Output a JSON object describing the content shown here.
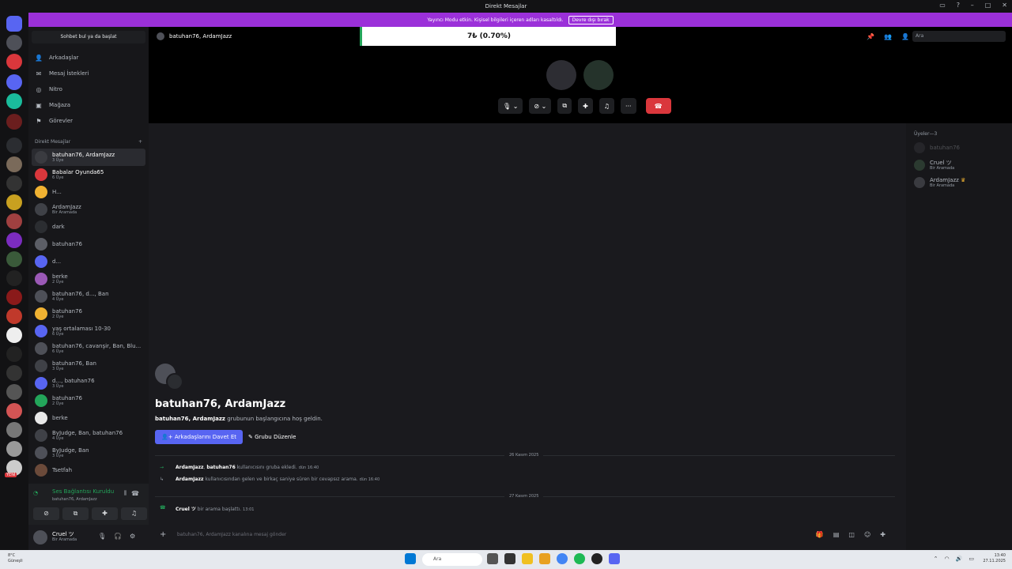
{
  "window": {
    "title": "Direkt Mesajlar"
  },
  "banner": {
    "text": "Yayıncı Modu etkin. Kişisel bilgileri içeren adları kasaltıldı.",
    "button": "Devre dışı bırak"
  },
  "sidebar": {
    "search_placeholder": "Sohbet bul ya da başlat",
    "nav": [
      "Arkadaşlar",
      "Mesaj İstekleri",
      "Nitro",
      "Mağaza",
      "Görevler"
    ],
    "dm_header": "Direkt Mesajlar",
    "dm_add": "+",
    "dms": [
      {
        "name": "batuhan76, ArdamJazz",
        "sub": "3 Üye",
        "color": "#3a3b40"
      },
      {
        "name": "Babalar Oyunda65",
        "sub": "6 Üye",
        "color": "#da373c"
      },
      {
        "name": "H...",
        "sub": "",
        "color": "#f0b232"
      },
      {
        "name": "ArdamJazz",
        "sub": "Bir Aramada",
        "color": "#3f4147"
      },
      {
        "name": "dark",
        "sub": "",
        "color": "#2b2d31"
      },
      {
        "name": "batuhan76",
        "sub": "",
        "color": "#5c5e66"
      },
      {
        "name": "d...",
        "sub": "",
        "color": "#5865f2"
      },
      {
        "name": "berke",
        "sub": "2 Üye",
        "color": "#9b59b6"
      },
      {
        "name": "batuhan76, d..., Ban",
        "sub": "4 Üye",
        "color": "#4e5058"
      },
      {
        "name": "batuhan76",
        "sub": "2 Üye",
        "color": "#f0b232"
      },
      {
        "name": "yaş ortalaması 10-30",
        "sub": "6 Üye",
        "color": "#5865f2"
      },
      {
        "name": "batuhan76, cavanşir, Ban, Blu...",
        "sub": "6 Üye",
        "color": "#4e5058"
      },
      {
        "name": "batuhan76, Ban",
        "sub": "3 Üye",
        "color": "#3f4147"
      },
      {
        "name": "d..., batuhan76",
        "sub": "3 Üye",
        "color": "#5865f2"
      },
      {
        "name": "batuhan76",
        "sub": "2 Üye",
        "color": "#23a55a"
      },
      {
        "name": "berke",
        "sub": "",
        "color": "#e8e8e8"
      },
      {
        "name": "ByJudge, Ban, batuhan76",
        "sub": "4 Üye",
        "color": "#3f4147"
      },
      {
        "name": "ByJudge, Ban",
        "sub": "3 Üye",
        "color": "#4e5058"
      },
      {
        "name": "Tsetfah",
        "sub": "",
        "color": "#6b4a3a"
      }
    ]
  },
  "guild_badges": {
    "yeni": "YENİ"
  },
  "voice": {
    "status": "Ses Bağlantısı Kuruldu",
    "channel": "batuhan76, ArdamJazz"
  },
  "user": {
    "name": "Cruel ツ",
    "status": "Bir Aramada"
  },
  "call": {
    "header": "batuhan76, ArdamJazz",
    "stream_text": "7₺ (0.70%)",
    "search_placeholder": "Ara"
  },
  "chat": {
    "title": "batuhan76, ArdamJazz",
    "welcome_bold": "batuhan76, ArdamJazz",
    "welcome_rest": " grubunun başlangıcına hoş geldin.",
    "invite_button": "Arkadaşlarını Davet Et",
    "edit_button": "Grubu Düzenle",
    "date1": "26 Kasım 2025",
    "msg1": {
      "u1": "ArdamJazz",
      "sep": ",",
      "u2": "batuhan76",
      "text": "kullanıcısını gruba ekledi.",
      "time": "dün 16:40"
    },
    "msg2": {
      "u1": "ArdamJazz",
      "text": "kullanıcısından gelen ve birkaç saniye süren bir cevapsız arama.",
      "time": "dün 16:40"
    },
    "date2": "27 Kasım 2025",
    "msg3": {
      "u1": "Cruel ツ",
      "text": "bir arama başlattı.",
      "time": "13:01"
    },
    "input_placeholder": "batuhan76, ArdamJazz kanalına mesaj gönder"
  },
  "members": {
    "header": "Üyeler—3",
    "list": [
      {
        "name": "batuhan76",
        "sub": ""
      },
      {
        "name": "Cruel ツ",
        "sub": "Bir Aramada"
      },
      {
        "name": "ArdamJazz",
        "sub": "Bir Aramada"
      }
    ]
  },
  "taskbar": {
    "weather_temp": "8°C",
    "weather_desc": "Güneşli",
    "search": "Ara",
    "time": "13:40",
    "date": "27.11.2025"
  }
}
